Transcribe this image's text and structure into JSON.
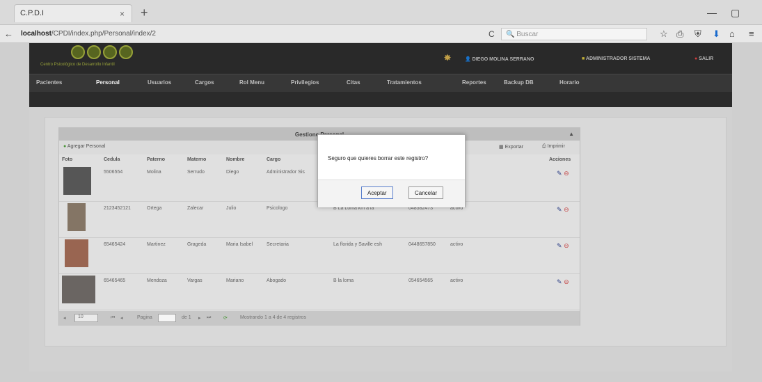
{
  "browser": {
    "tab_title": "C.P.D.I",
    "tab_close": "×",
    "new_tab": "+",
    "url_host": "localhost",
    "url_path": "/CPDI/index.php/Personal/index/2",
    "search_placeholder": "Buscar",
    "back": "←",
    "reload": "C",
    "win_min": "—",
    "win_max": "▢",
    "tools": [
      "☆",
      "⎙",
      "⛨",
      "⬇",
      "⌂",
      "≡"
    ]
  },
  "header": {
    "logo_subtitle": "Centro Psicológico de Desarrollo Infantil",
    "user_name": "DIEGO MOLINA SERRANO",
    "role": "ADMINISTRADOR SISTEMA",
    "logout": "SALIR"
  },
  "nav": {
    "items": [
      "Pacientes",
      "Personal",
      "Usuarios",
      "Cargos",
      "Rol Menu",
      "Privilegios",
      "Citas",
      "Tratamientos",
      "Reportes",
      "Backup DB",
      "Horario"
    ],
    "active": "Personal"
  },
  "grid": {
    "title": "Gestione Personal",
    "add_label": "Agregar Personal",
    "export_label": "Exportar",
    "print_label": "Imprimir",
    "columns": [
      "Foto",
      "Cedula",
      "Paterno",
      "Materno",
      "Nombre",
      "Cargo",
      "",
      "",
      "",
      "Acciones"
    ],
    "rows": [
      {
        "cedula": "5506554",
        "paterno": "Molina",
        "materno": "Serrudo",
        "nombre": "Diego",
        "cargo": "Administrador Sis",
        "direccion": "",
        "telefono": "",
        "estado": ""
      },
      {
        "cedula": "2123452121",
        "paterno": "Ortega",
        "materno": "Zalecar",
        "nombre": "Julio",
        "cargo": "Psicologo",
        "direccion": "B La Loma km a la",
        "telefono": "048582473",
        "estado": "activo"
      },
      {
        "cedula": "65465424",
        "paterno": "Martinez",
        "materno": "Grageda",
        "nombre": "Maria Isabel",
        "cargo": "Secretaria",
        "direccion": "La florida y Saville esh",
        "telefono": "0448657850",
        "estado": "activo"
      },
      {
        "cedula": "65465465",
        "paterno": "Mendoza",
        "materno": "Vargas",
        "nombre": "Mariano",
        "cargo": "Abogado",
        "direccion": "B la loma",
        "telefono": "054654565",
        "estado": "activo"
      }
    ],
    "pager": {
      "page_size": "10",
      "page_label": "Pagina",
      "of_label": "de 1",
      "summary": "Mostrando 1 a 4 de 4 registros"
    }
  },
  "modal": {
    "message": "Seguro que quieres borrar este registro?",
    "accept": "Aceptar",
    "cancel": "Cancelar"
  }
}
